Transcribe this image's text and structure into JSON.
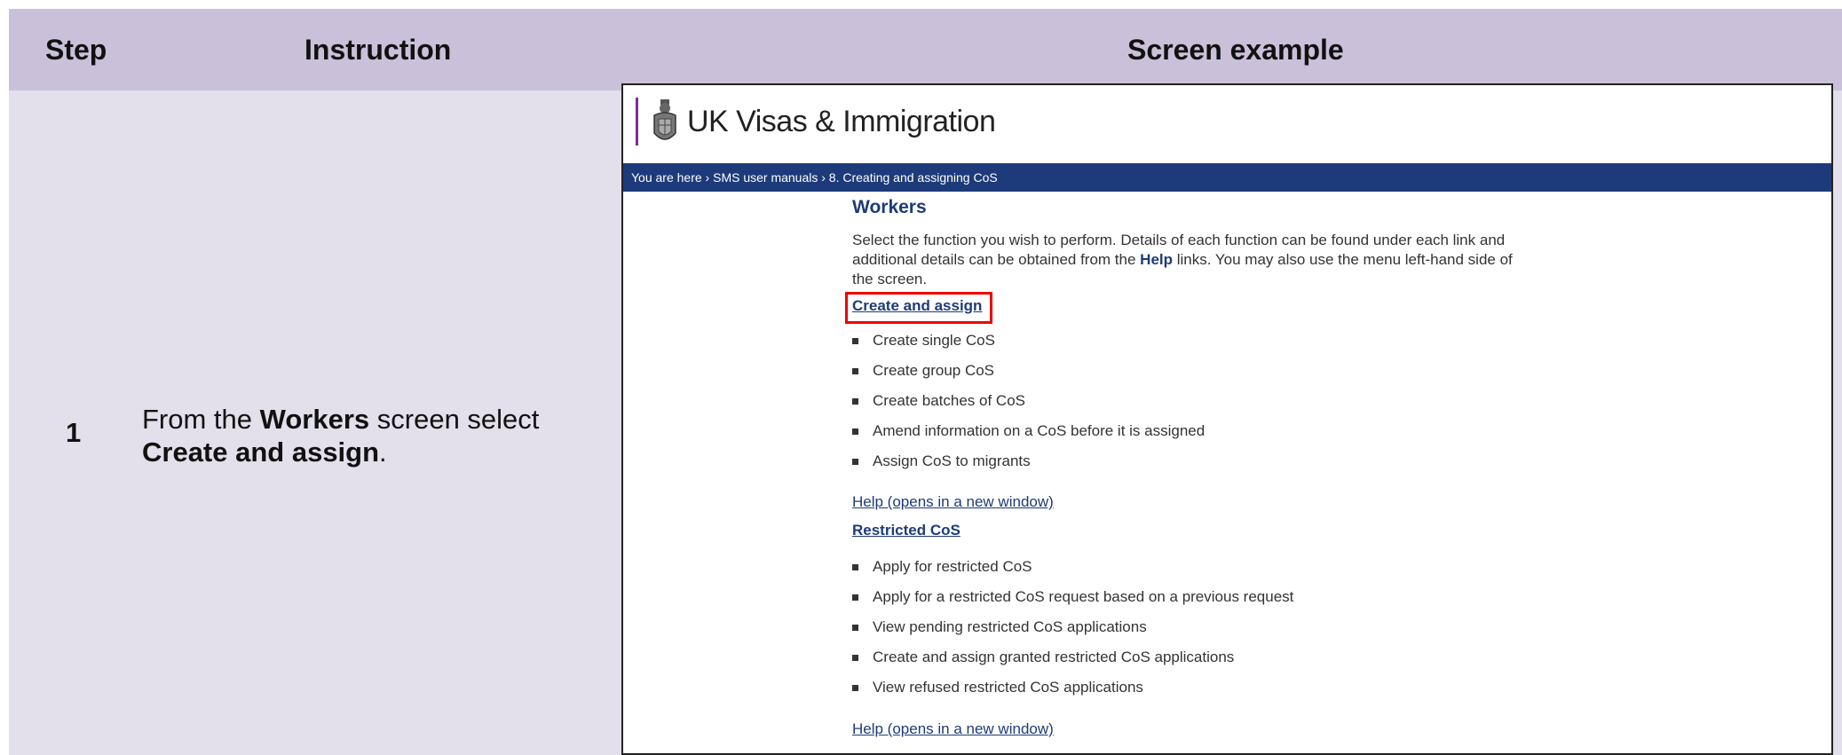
{
  "headers": {
    "step": "Step",
    "instruction": "Instruction",
    "screen": "Screen example"
  },
  "row": {
    "step": "1",
    "instruction": {
      "prefix": "From the ",
      "workers": "Workers",
      "middle": " screen select ",
      "create": "Create and assign",
      "suffix": "."
    }
  },
  "screen": {
    "site_title": "UK Visas & Immigration",
    "breadcrumb": "You are here › SMS user manuals ›  8. Creating and assigning CoS",
    "heading": "Workers",
    "intro": {
      "text1": "Select the function you wish to perform. Details of each function can be found under each link and additional details can be obtained from the ",
      "help": "Help",
      "text2": " links. You may also use the menu left-hand side of the screen."
    },
    "create_assign": {
      "link": "Create and assign",
      "items": [
        "Create single CoS",
        "Create group CoS",
        "Create batches of CoS",
        "Amend information on a CoS before it is assigned",
        "Assign CoS to migrants"
      ],
      "help_link": "Help (opens in a new window)"
    },
    "restricted": {
      "link": "Restricted CoS",
      "items": [
        "Apply for restricted CoS",
        "Apply for a restricted CoS request based on a previous request",
        "View pending restricted CoS applications",
        "Create and assign granted restricted CoS applications",
        "View refused restricted CoS applications"
      ],
      "help_link": "Help (opens in a new window)"
    },
    "icons": {
      "crest": "royal-crest-icon"
    },
    "colors": {
      "header_bg": "#cbc0d9",
      "row_bg": "#e3dfeb",
      "breadcrumb_bg": "#1d3b7a",
      "link": "#1d3b7a",
      "highlight": "#ee0000",
      "logo_bar": "#7c2c93"
    }
  }
}
